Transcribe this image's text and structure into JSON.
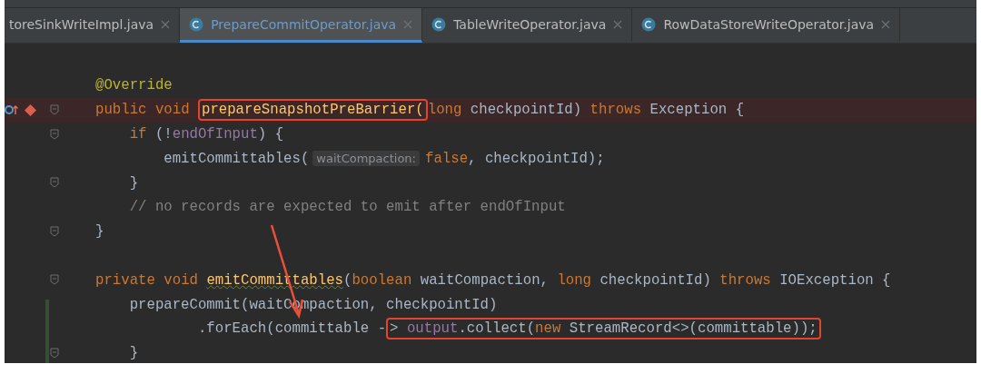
{
  "tabs": [
    {
      "label": "toreSinkWriteImpl.java",
      "selected": false
    },
    {
      "label": "PrepareCommitOperator.java",
      "icon": true,
      "selected": true
    },
    {
      "label": "TableWriteOperator.java",
      "icon": true,
      "selected": false
    },
    {
      "label": "RowDataStoreWriteOperator.java",
      "icon": true,
      "selected": false
    }
  ],
  "lines": [
    {
      "kind": "statement",
      "tokens": [
        {
          "kind": "annotation",
          "text": "@Override"
        }
      ]
    },
    {
      "kind": "statement",
      "fold": true,
      "breakpoint": true,
      "tokens": [
        {
          "kind": "keyword",
          "text": "public void "
        },
        {
          "kind": "method",
          "text": "prepareSnapshotPreBarrier(",
          "highlight": true
        },
        {
          "kind": "keyword",
          "text": "long "
        },
        {
          "kind": "plain",
          "text": "checkpointId) "
        },
        {
          "kind": "keyword",
          "text": "throws "
        },
        {
          "kind": "plain",
          "text": "Exception {"
        }
      ],
      "children": [
        {
          "kind": "statement",
          "fold": true,
          "tokens": [
            {
              "kind": "keyword",
              "text": "if "
            },
            {
              "kind": "plain",
              "text": "(!"
            },
            {
              "kind": "field",
              "text": "endOfInput"
            },
            {
              "kind": "plain",
              "text": ") {"
            }
          ],
          "children": [
            {
              "kind": "statement",
              "tokens": [
                {
                  "kind": "plain",
                  "text": "emitCommittables("
                },
                {
                  "kind": "hint",
                  "text": "waitCompaction:"
                },
                {
                  "kind": "keyword",
                  "text": "false"
                },
                {
                  "kind": "plain",
                  "text": ", checkpointId);"
                }
              ]
            }
          ]
        },
        {
          "kind": "statement",
          "fold": true,
          "tokens": [
            {
              "kind": "plain",
              "text": "}"
            }
          ]
        },
        {
          "kind": "statement",
          "tokens": [
            {
              "kind": "comment",
              "text": "// no records are expected to emit after endOfInput"
            }
          ]
        }
      ]
    },
    {
      "kind": "statement",
      "fold": true,
      "tokens": [
        {
          "kind": "plain",
          "text": "}"
        }
      ]
    },
    {
      "kind": "blank"
    },
    {
      "kind": "statement",
      "fold": true,
      "tokens": [
        {
          "kind": "keyword",
          "text": "private void "
        },
        {
          "kind": "method",
          "text": "emitCommittables"
        },
        {
          "kind": "plain",
          "text": "("
        },
        {
          "kind": "keyword",
          "text": "boolean "
        },
        {
          "kind": "plain",
          "text": "waitCompaction, "
        },
        {
          "kind": "keyword",
          "text": "long "
        },
        {
          "kind": "plain",
          "text": "checkpointId) "
        },
        {
          "kind": "keyword",
          "text": "throws "
        },
        {
          "kind": "plain",
          "text": "IOException {"
        }
      ],
      "children": [
        {
          "kind": "statement",
          "tokens": [
            {
              "kind": "plain",
              "text": "prepareCommit(waitCompaction, checkpointId)"
            }
          ],
          "children": [
            {
              "kind": "continuation",
              "tokens": [
                {
                  "kind": "plain",
                  "text": ".forEach(committable -"
                },
                {
                  "kind": "plain",
                  "text": "> ",
                  "highlight": true
                },
                {
                  "kind": "field",
                  "text": "output",
                  "highlight": true
                },
                {
                  "kind": "plain",
                  "text": ".collect(",
                  "highlight": true
                },
                {
                  "kind": "keyword",
                  "text": "new ",
                  "highlight": true
                },
                {
                  "kind": "plain",
                  "text": "StreamRecord<>(committable));",
                  "highlight": true
                }
              ]
            }
          ]
        },
        {
          "kind": "statement",
          "fold": true,
          "tokens": [
            {
              "kind": "plain",
              "text": "}"
            }
          ]
        }
      ]
    }
  ]
}
